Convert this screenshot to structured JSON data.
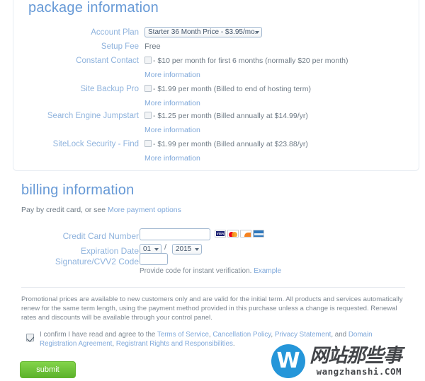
{
  "package": {
    "title": "package information",
    "rows": [
      {
        "label": "Account Plan",
        "type": "select",
        "value": "Starter 36 Month Price - $3.95/mo."
      },
      {
        "label": "Setup Fee",
        "type": "text",
        "value": "Free"
      },
      {
        "label": "Constant Contact",
        "type": "checkbox",
        "checked": false,
        "value": "- $10 per month for first 6 months (normally $20 per month)",
        "more_link": "More information"
      },
      {
        "label": "Site Backup Pro",
        "type": "checkbox",
        "checked": false,
        "value": "- $1.99 per month (Billed to end of hosting term)",
        "more_link": "More information"
      },
      {
        "label": "Search Engine Jumpstart",
        "type": "checkbox",
        "checked": false,
        "value": "- $1.25 per month (Billed annually at $14.99/yr)",
        "more_link": "More information"
      },
      {
        "label": "SiteLock Security - Find",
        "type": "checkbox",
        "checked": false,
        "value": "- $1.99 per month (Billed annually at $23.88/yr)",
        "more_link": "More information"
      }
    ]
  },
  "billing": {
    "title": "billing information",
    "pay_prefix": "Pay by credit card, or see ",
    "pay_link": "More payment options",
    "credit_card_label": "Credit Card Number",
    "credit_card_value": "",
    "expiration_label": "Expiration Date",
    "exp_month": "01",
    "exp_year": "2015",
    "separator": "/",
    "cvv_label": "Signature/CVV2 Code",
    "cvv_value": "",
    "cvv_hint_prefix": "Provide code for instant verification. ",
    "cvv_hint_link": "Example",
    "cards": [
      {
        "name": "visa-card-icon",
        "text": "VISA"
      },
      {
        "name": "mastercard-card-icon",
        "text": ""
      },
      {
        "name": "discover-card-icon",
        "text": "DISC"
      },
      {
        "name": "amex-card-icon",
        "text": "AMEX"
      }
    ]
  },
  "legal": {
    "promo_text": "Promotional prices are available to new customers only and are valid for the initial term. All products and services automatically renew for the same term length, using the payment method provided in this purchase unless a change is requested. Renewal rates and discounts will be available through your control panel.",
    "confirm_checked": true,
    "confirm_prefix": "I confirm I have read and agree to the ",
    "confirm_links": [
      "Terms of Service",
      "Cancellation Policy",
      "Privacy Statement",
      "Domain Registration Agreement",
      "Registrant Rights and Responsibilities"
    ],
    "confirm_join": ", ",
    "confirm_and": ", and ",
    "confirm_end": "."
  },
  "submit": {
    "label": "submit"
  },
  "watermark": {
    "mark": "W",
    "chinese": "网站那些事",
    "url": "wangzhanshi.COM"
  },
  "colors": {
    "heading": "#6699d6",
    "label": "#8fb3dd",
    "link": "#7fa8da",
    "submit": "#5cb22b",
    "watermark": "#1e93d8"
  }
}
